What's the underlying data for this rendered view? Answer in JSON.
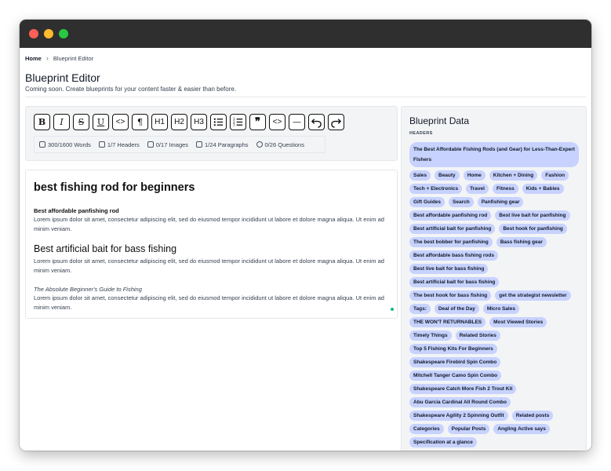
{
  "breadcrumb": {
    "home": "Home",
    "separator": "›",
    "current": "Blueprint Editor"
  },
  "page": {
    "title": "Blueprint Editor",
    "subtitle": "Coming soon. Create blueprints for your content faster & easier than before."
  },
  "toolbar": {
    "tools": [
      {
        "name": "bold",
        "label": "B"
      },
      {
        "name": "italic",
        "label": "I"
      },
      {
        "name": "strikethrough",
        "label": "S"
      },
      {
        "name": "underline",
        "label": "U"
      },
      {
        "name": "code",
        "label": "<>"
      },
      {
        "name": "paragraph",
        "label": "¶"
      },
      {
        "name": "h1",
        "label": "H1"
      },
      {
        "name": "h2",
        "label": "H2"
      },
      {
        "name": "h3",
        "label": "H3"
      },
      {
        "name": "bullet-list",
        "label": ""
      },
      {
        "name": "ordered-list",
        "label": ""
      },
      {
        "name": "blockquote",
        "label": "❞"
      },
      {
        "name": "code-block",
        "label": "<>"
      },
      {
        "name": "horizontal-rule",
        "label": "—"
      },
      {
        "name": "undo",
        "label": ""
      },
      {
        "name": "redo",
        "label": ""
      }
    ]
  },
  "stats": {
    "words": "300/1600 Words",
    "headers": "1/7 Headers",
    "images": "0/17 Images",
    "paragraphs": "1/24 Paragraphs",
    "questions": "0/26 Questions"
  },
  "document": {
    "h1": "best fishing rod for beginners",
    "h3": "Best affordable panfishing rod",
    "p1": "Lorem ipsum dolor sit amet, consectetur adipiscing elit, sed do eiusmod tempor incididunt ut labore et dolore magna aliqua. Ut enim ad minim veniam.",
    "h2": "Best artificial bait for bass fishing",
    "p2": "Lorem ipsum dolor sit amet, consectetur adipiscing elit, sed do eiusmod tempor incididunt ut labore et dolore magna aliqua. Ut enim ad minim veniam.",
    "em": "The Absolute Beginner's Guide to Fishing",
    "p3": "Lorem ipsum dolor sit amet, consectetur adipiscing elit, sed do eiusmod tempor incididunt ut labore et dolore magna aliqua. Ut enim ad minim veniam."
  },
  "blueprint": {
    "title": "Blueprint Data",
    "section": "HEADERS",
    "tags": [
      "The Best Affordable Fishing Rods (and Gear) for Less-Than-Expert Fishers",
      "Sales",
      "Beauty",
      "Home",
      "Kitchen + Dining",
      "Fashion",
      "Tech + Electronics",
      "Travel",
      "Fitness",
      "Kids + Babies",
      "Gift Guides",
      "Search",
      "Panfishing gear",
      "Best affordable panfishing rod",
      "Best live bait for panfishing",
      "Best artificial bait for panfishing",
      "Best hook for panfishing",
      "The best bobber for panfishing",
      "Bass fishing gear",
      "Best affordable bass fishing rods",
      "Best live bait for bass fishing",
      "Best artificial bait for bass fishing",
      "The best hook for bass fishing",
      "get the strategist newsletter",
      "Tags:",
      "Deal of the Day",
      "Micro Sales",
      "THE WON'T RETURNABLES",
      "Most Viewed Stories",
      "Timely Things",
      "Related Stories",
      "Top 5 Fishing Kits For Beginners",
      "Shakespeare Firebird Spin Combo",
      "Mitchell Tanger Camo Spin Combo",
      "Shakespeare Catch More Fish 2 Trout Kit",
      "Abu Garcia Cardinal All Round Combo",
      "Shakespeare Agility 2 Spinning Outfit",
      "Related posts",
      "Categories",
      "Popular Posts",
      "Angling Active says",
      "Specification at a glance"
    ]
  },
  "colors": {
    "titlebar": "#2f2f2f",
    "tag_bg": "#c7d2fe",
    "panel_bg": "#f3f4f6",
    "status_dot": "#10b981"
  }
}
